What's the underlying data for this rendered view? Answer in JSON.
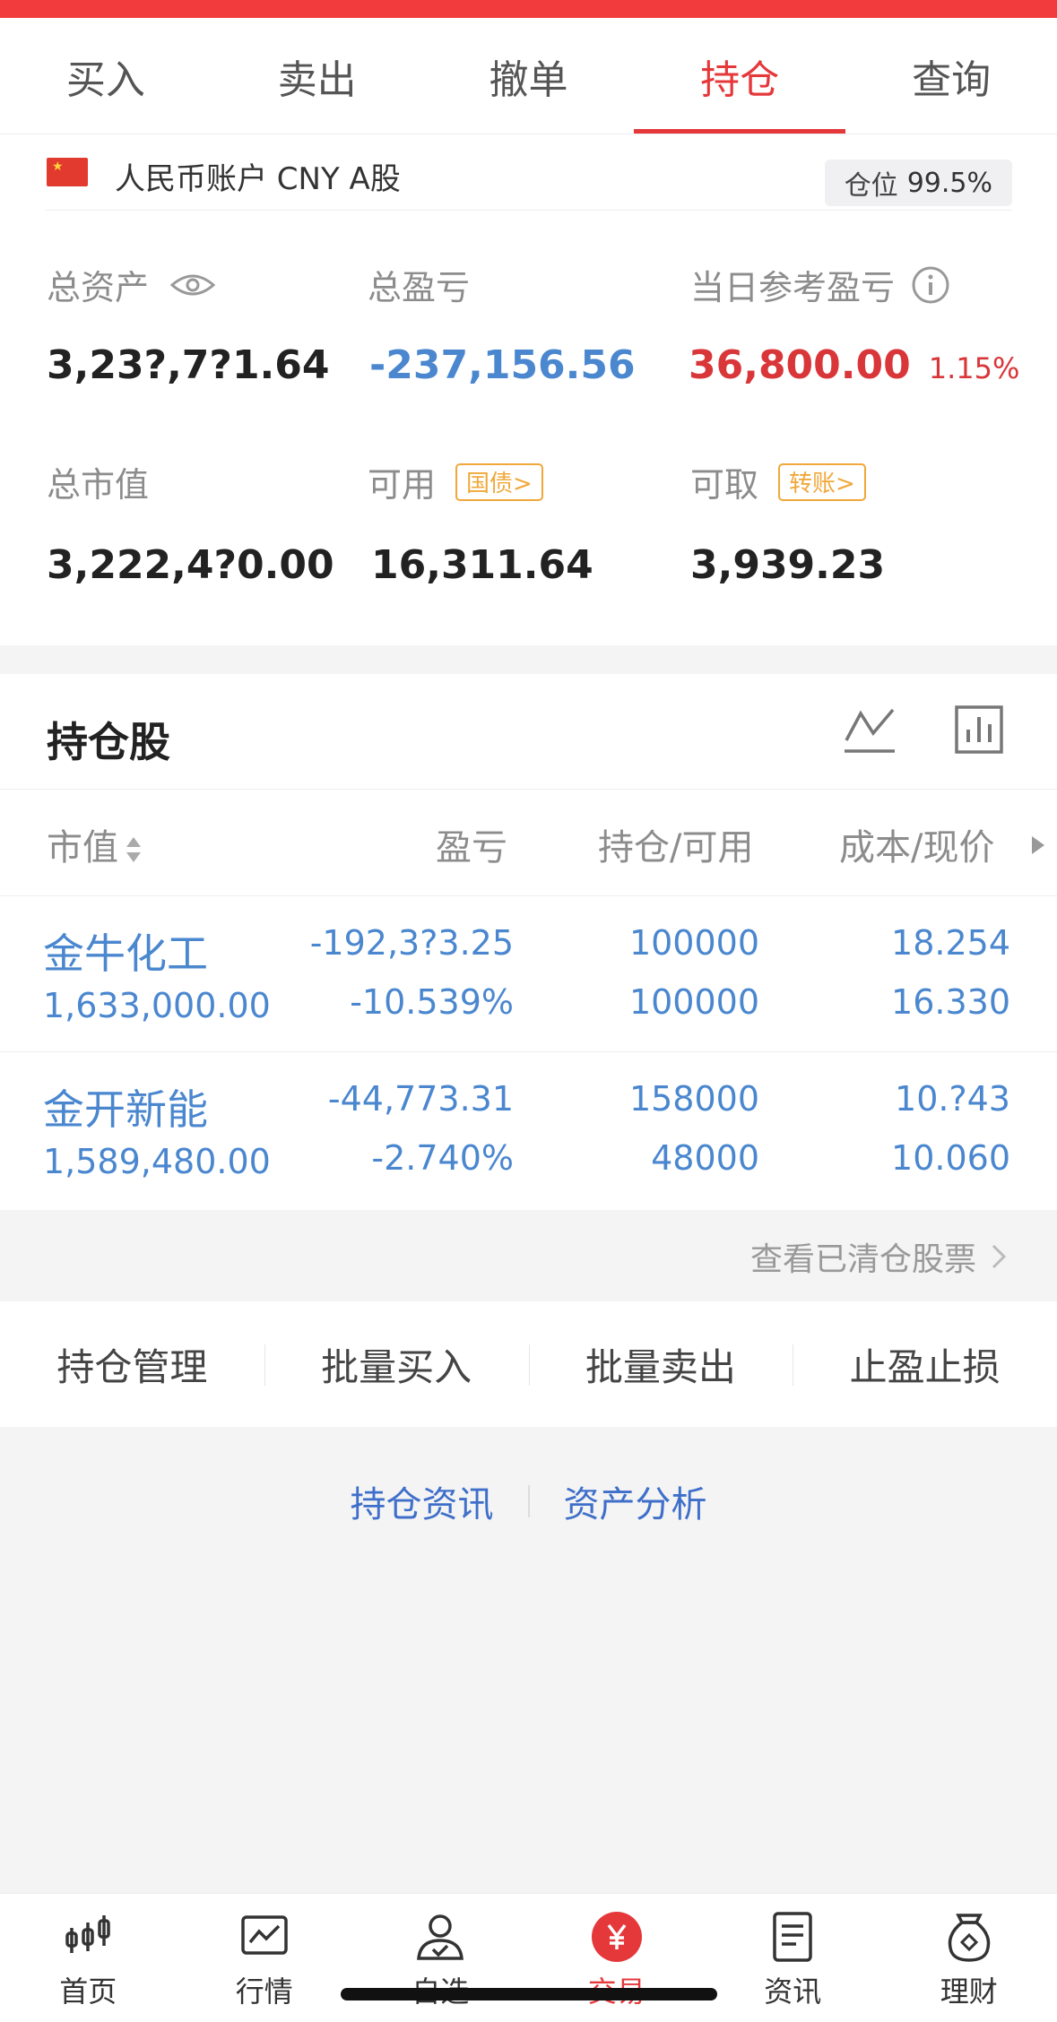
{
  "tabs": [
    "买入",
    "卖出",
    "撤单",
    "持仓",
    "查询"
  ],
  "active_tab": "持仓",
  "account": {
    "name": "人民币账户 CNY A股",
    "position_label": "仓位",
    "position_value": "99.5%"
  },
  "stats": {
    "total_assets_label": "总资产",
    "total_assets_value": "3,23?,7?1.64",
    "total_pnl_label": "总盈亏",
    "total_pnl_value": "-237,156.56",
    "daily_pnl_label": "当日参考盈亏",
    "daily_pnl_value": "36,800.00",
    "daily_pnl_pct": "1.15%",
    "market_value_label": "总市值",
    "market_value_value": "3,222,4?0.00",
    "available_label": "可用",
    "available_tag": "国债>",
    "available_value": "16,311.64",
    "withdrawable_label": "可取",
    "withdrawable_tag": "转账>",
    "withdrawable_value": "3,939.23"
  },
  "holdings": {
    "title": "持仓股",
    "columns": [
      "市值",
      "盈亏",
      "持仓/可用",
      "成本/现价"
    ],
    "rows": [
      {
        "name": "金牛化工",
        "market_value": "1,633,000.00",
        "pnl": "-192,3?3.25",
        "pnl_pct": "-10.539%",
        "holding": "100000",
        "available": "100000",
        "cost": "18.254",
        "price": "16.330"
      },
      {
        "name": "金开新能",
        "market_value": "1,589,480.00",
        "pnl": "-44,773.31",
        "pnl_pct": "-2.740%",
        "holding": "158000",
        "available": "48000",
        "cost": "10.?43",
        "price": "10.060"
      }
    ]
  },
  "cleared_link": "查看已清仓股票",
  "actions": [
    "持仓管理",
    "批量买入",
    "批量卖出",
    "止盈止损"
  ],
  "links": [
    "持仓资讯",
    "资产分析"
  ],
  "nav": [
    {
      "label": "首页",
      "icon": "candlestick-icon"
    },
    {
      "label": "行情",
      "icon": "chart-window-icon"
    },
    {
      "label": "自选",
      "icon": "person-check-icon"
    },
    {
      "label": "交易",
      "icon": "yuan-circle-icon"
    },
    {
      "label": "资讯",
      "icon": "document-icon"
    },
    {
      "label": "理财",
      "icon": "money-bag-icon"
    }
  ],
  "colors": {
    "accent": "#e5383b",
    "blue": "#4a87cf",
    "orange": "#f0a83a"
  }
}
